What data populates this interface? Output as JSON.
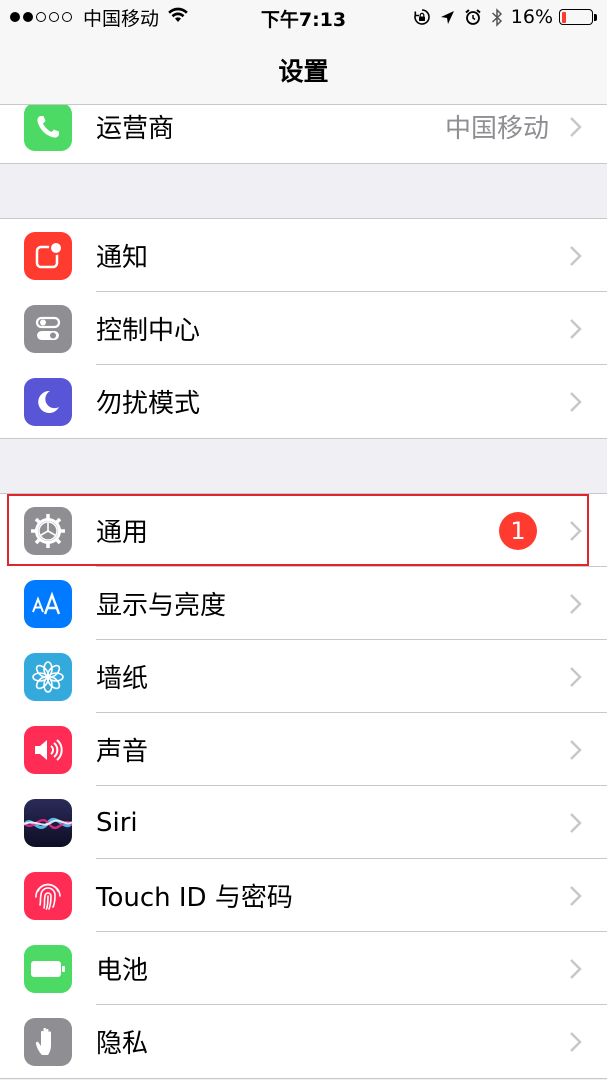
{
  "status_bar": {
    "carrier": "中国移动",
    "time": "下午7:13",
    "battery_percent": "16%",
    "battery_level": 0.16,
    "icons": [
      "signal-dots-icon",
      "wifi-icon",
      "rotation-lock-icon",
      "location-icon",
      "alarm-icon",
      "bluetooth-icon",
      "battery-icon"
    ]
  },
  "nav": {
    "title": "设置"
  },
  "groups": [
    {
      "rows": [
        {
          "label": "运营商",
          "value": "中国移动",
          "icon": "phone-icon",
          "color": "#4cd964"
        }
      ]
    },
    {
      "rows": [
        {
          "label": "通知",
          "icon": "notifications-icon",
          "color": "#ff3b30"
        },
        {
          "label": "控制中心",
          "icon": "control-center-icon",
          "color": "#8e8e93"
        },
        {
          "label": "勿扰模式",
          "icon": "moon-icon",
          "color": "#5856d6"
        }
      ]
    },
    {
      "rows": [
        {
          "label": "通用",
          "badge": "1",
          "icon": "gear-icon",
          "color": "#8e8e93"
        },
        {
          "label": "显示与亮度",
          "icon": "text-size-icon",
          "color": "#007aff"
        },
        {
          "label": "墙纸",
          "icon": "flower-icon",
          "color": "#34aadc"
        },
        {
          "label": "声音",
          "icon": "speaker-icon",
          "color": "#ff2d55"
        },
        {
          "label": "Siri",
          "icon": "siri-icon",
          "color": "#1a1a3a"
        },
        {
          "label": "Touch ID 与密码",
          "icon": "fingerprint-icon",
          "color": "#ff2d55"
        },
        {
          "label": "电池",
          "icon": "battery-icon",
          "color": "#4cd964"
        },
        {
          "label": "隐私",
          "icon": "hand-icon",
          "color": "#8e8e93"
        }
      ]
    }
  ],
  "colors": {
    "background": "#efeff4",
    "separator": "#c8c7cc",
    "badge": "#ff3b30",
    "highlight": "#e0262a"
  }
}
